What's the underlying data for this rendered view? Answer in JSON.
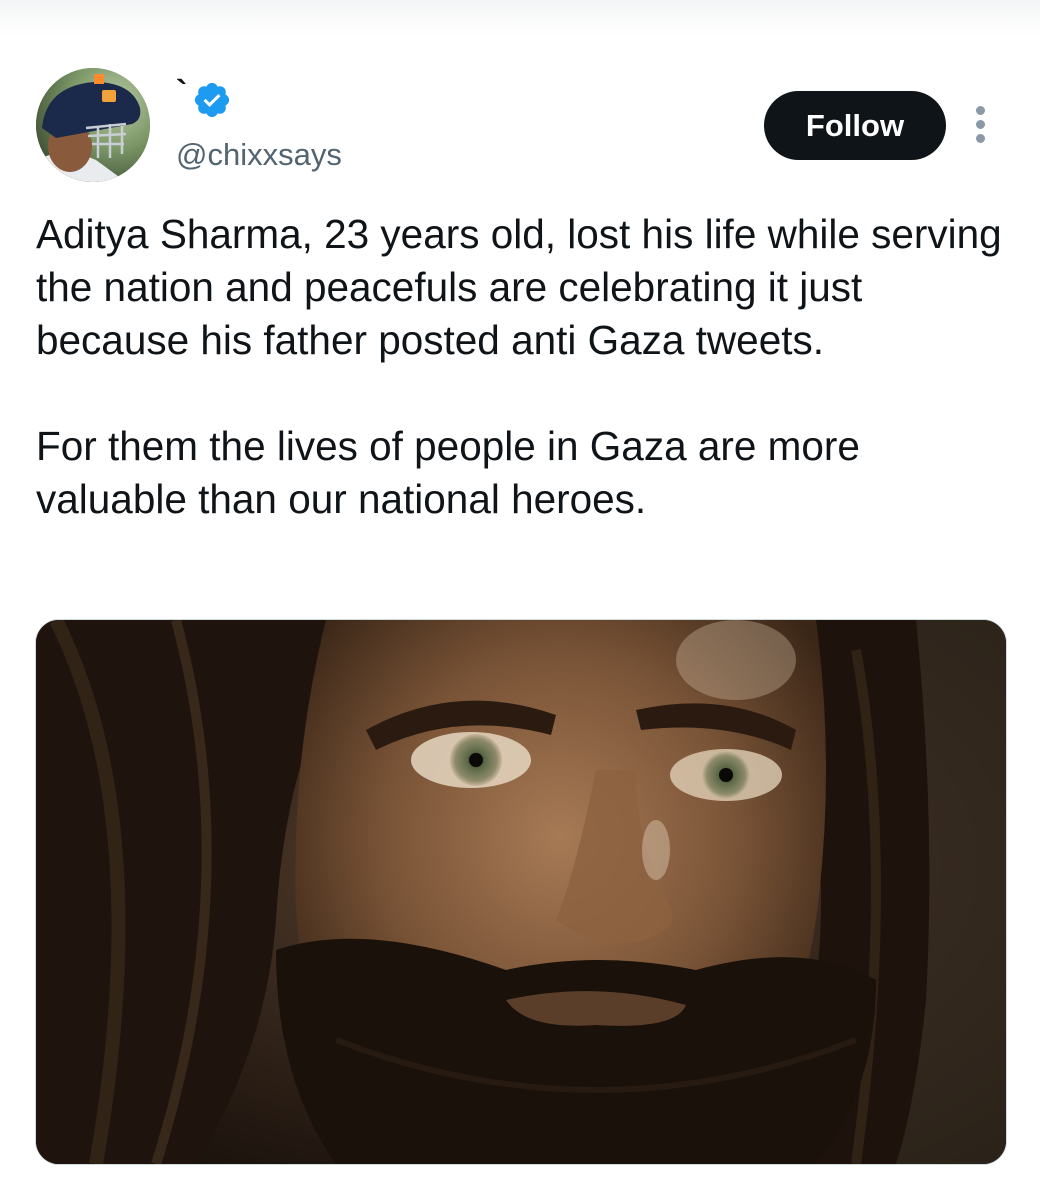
{
  "author": {
    "display_name": "`",
    "handle": "@chixxsays",
    "verified": true,
    "avatar_icon": "avatar-cricketer-helmet"
  },
  "actions": {
    "follow_label": "Follow",
    "more_icon": "more-vertical-icon"
  },
  "tweet": {
    "paragraphs": [
      "Aditya Sharma, 23 years old, lost his life while serving the nation and peacefuls are celebrating it just because his father posted anti Gaza tweets.",
      "For them the lives of people in Gaza are more valuable than our national heroes."
    ]
  },
  "media": {
    "type": "image",
    "subject": "close-up of a bearded man with long hair staring forward"
  },
  "colors": {
    "text_primary": "#0f1419",
    "text_secondary": "#536471",
    "verified_blue": "#1d9bf0",
    "follow_bg": "#0f1419",
    "follow_text": "#ffffff"
  }
}
